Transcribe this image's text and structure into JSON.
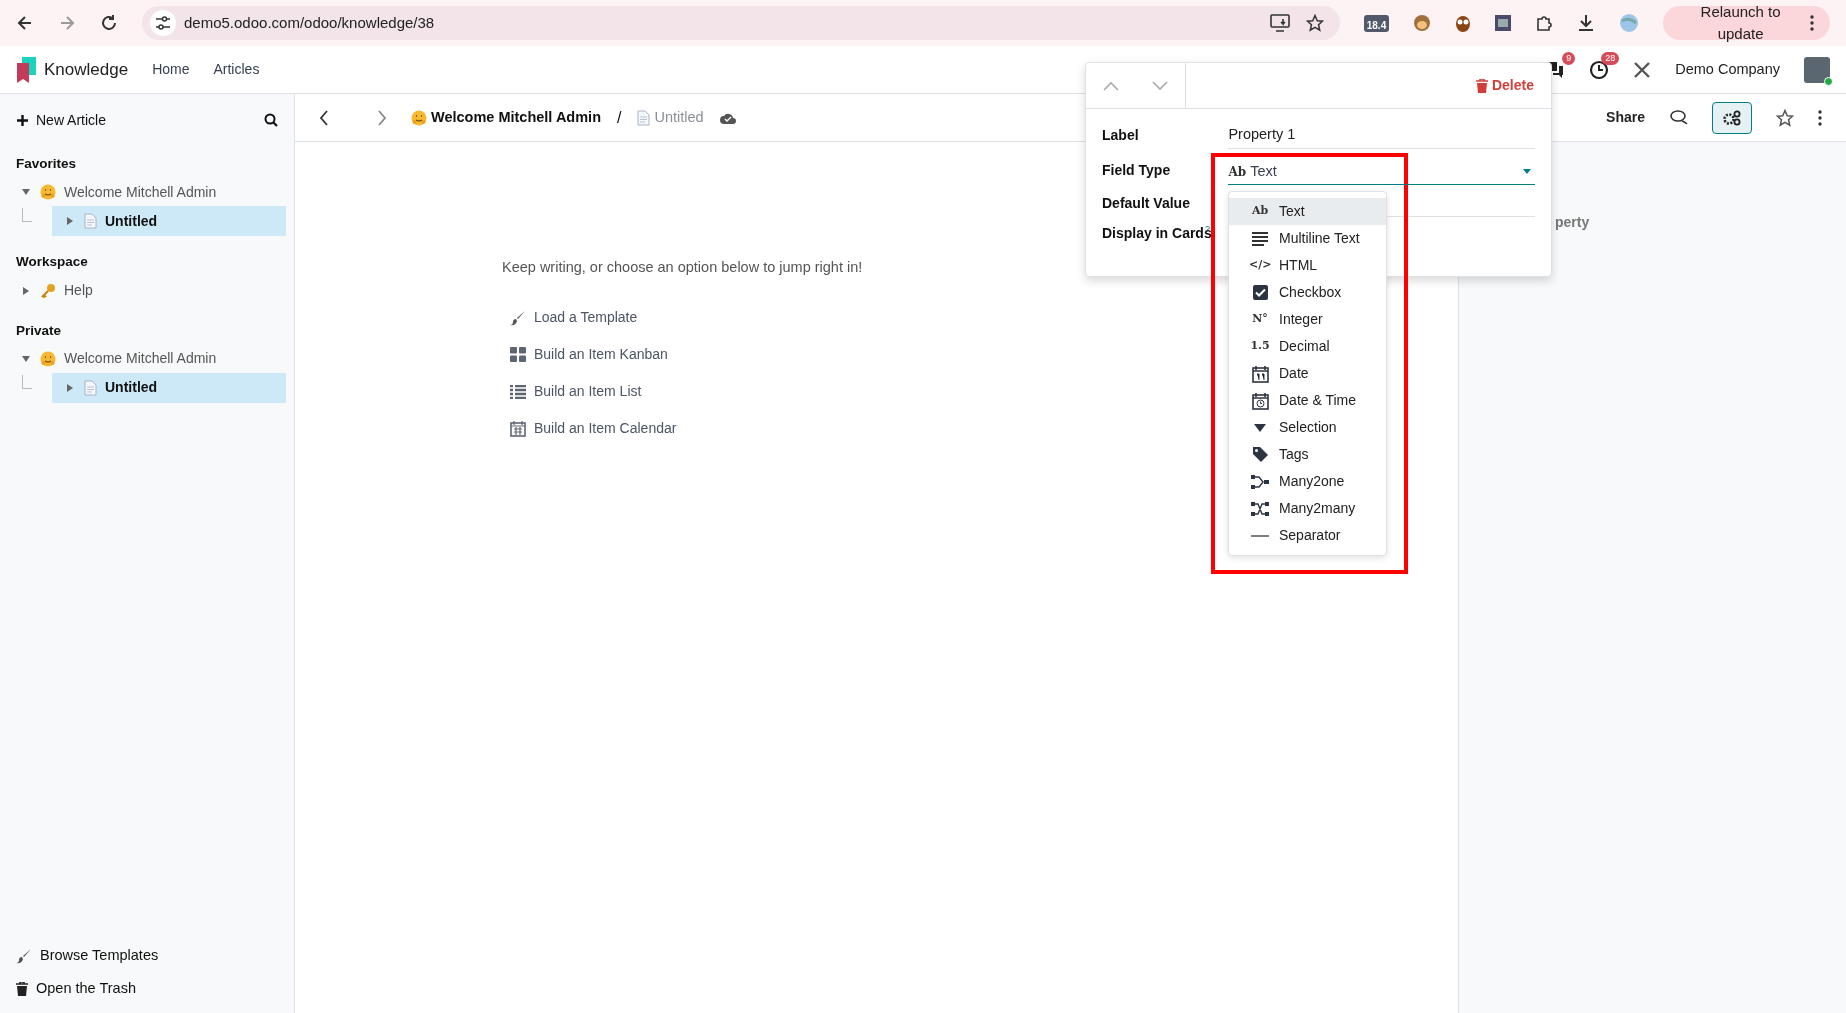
{
  "browser": {
    "url": "demo5.odoo.com/odoo/knowledge/38",
    "extension_badge": "18.4",
    "relaunch_button": "Relaunch to update"
  },
  "app": {
    "name": "Knowledge",
    "menu": [
      "Home",
      "Articles"
    ],
    "chat_count": "9",
    "activity_count": "28",
    "company": "Demo Company"
  },
  "sidebar": {
    "new_article": "New Article",
    "sections": [
      {
        "title": "Favorites",
        "items": [
          {
            "label": "Welcome Mitchell Admin",
            "kind": "hug",
            "expanded": true,
            "selected": false,
            "children": [
              {
                "label": "Untitled",
                "kind": "page",
                "expanded": false,
                "selected": true
              }
            ]
          }
        ]
      },
      {
        "title": "Workspace",
        "items": [
          {
            "label": "Help",
            "kind": "key",
            "expanded": false,
            "selected": false
          }
        ]
      },
      {
        "title": "Private",
        "items": [
          {
            "label": "Welcome Mitchell Admin",
            "kind": "hug",
            "expanded": true,
            "selected": false,
            "children": [
              {
                "label": "Untitled",
                "kind": "page",
                "expanded": false,
                "selected": true
              }
            ]
          }
        ]
      }
    ],
    "footer": [
      {
        "label": "Browse Templates",
        "kind": "brush"
      },
      {
        "label": "Open the Trash",
        "kind": "trash"
      }
    ]
  },
  "breadcrumb": {
    "separator": "/",
    "items": [
      {
        "label": "Welcome Mitchell Admin",
        "kind": "hug",
        "current": false
      },
      {
        "label": "Untitled",
        "kind": "page",
        "current": true
      }
    ]
  },
  "toolbar": {
    "share": "Share",
    "properties_on": true
  },
  "content": {
    "prompt": "Keep writing, or choose an option below to jump right in!",
    "options": [
      {
        "label": "Load a Template",
        "kind": "brush"
      },
      {
        "label": "Build an Item Kanban",
        "kind": "grid"
      },
      {
        "label": "Build an Item List",
        "kind": "list"
      },
      {
        "label": "Build an Item Calendar",
        "kind": "calendar"
      }
    ]
  },
  "properties_panel": {
    "partial_text": "perty"
  },
  "property_popup": {
    "delete": "Delete",
    "label": {
      "label": "Label",
      "value": "Property 1"
    },
    "field_type": {
      "label": "Field Type",
      "glyph": "Ab",
      "value": "Text",
      "highlighted": true
    },
    "default_value_label": "Default Value",
    "display_in_cards_label": "Display in Cards",
    "help_mark": "?",
    "options": [
      {
        "label": "Text",
        "kind": "glyph",
        "glyph": "Ab",
        "selected": true
      },
      {
        "label": "Multiline Text",
        "kind": "lines",
        "selected": false
      },
      {
        "label": "HTML",
        "kind": "glyph",
        "glyph": "</>",
        "selected": false
      },
      {
        "label": "Checkbox",
        "kind": "checkbox",
        "selected": false
      },
      {
        "label": "Integer",
        "kind": "glyph",
        "glyph": "N°",
        "selected": false
      },
      {
        "label": "Decimal",
        "kind": "glyph",
        "glyph": "1.5",
        "selected": false
      },
      {
        "label": "Date",
        "kind": "date",
        "selected": false
      },
      {
        "label": "Date & Time",
        "kind": "datetime",
        "selected": false
      },
      {
        "label": "Selection",
        "kind": "triangle",
        "selected": false
      },
      {
        "label": "Tags",
        "kind": "tag",
        "selected": false
      },
      {
        "label": "Many2one",
        "kind": "many2one",
        "selected": false
      },
      {
        "label": "Many2many",
        "kind": "many2many",
        "selected": false
      },
      {
        "label": "Separator",
        "kind": "separator",
        "selected": false
      }
    ]
  }
}
